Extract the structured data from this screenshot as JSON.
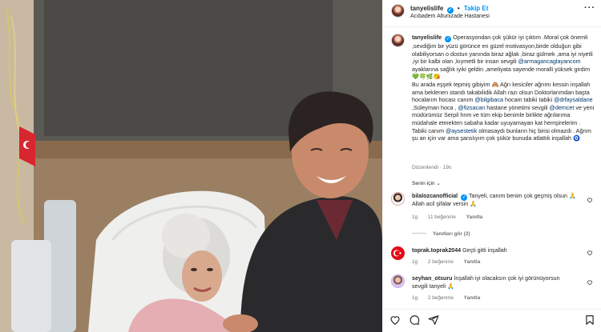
{
  "post": {
    "username": "tanyelislife",
    "verified_glyph": "✓",
    "follow_label": "Takip Et",
    "separator": "•",
    "location": "Acıbadem Altunizade Hastanesi",
    "more_glyph": "···"
  },
  "caption": {
    "username": "tanyelislife",
    "segments": [
      {
        "t": "Operasyondan çok şükür iyi çıktım .Moral çok önemli ,sevdiğim bir yüzü görünce en güzel motivasyon,birde olduğun gibi olabiliyorsan o dostun yanında biraz ağlak ,biraz gülmek ,ama iyi niyetli ,iyi bir kalbi olan ,kıymetli bir insan sevgili "
      },
      {
        "t": "@armagancaglayancom",
        "m": true
      },
      {
        "t": " ayaklarına sağlık iyiki geldin ,ameliyata sayende moralli yüksek girdim 💚🍀🌿😘"
      },
      {
        "br": true
      },
      {
        "t": "Bu arada eşşek tepmiş gibiyim 🙈 Ağrı kesiciler ağrımı kessin inşallah ama beklenen standı takabilidik Allah razı olsun Doktorlarımdan başta hocalarım hocası canım "
      },
      {
        "t": "@bilgibaca",
        "m": true
      },
      {
        "t": " hocam tabiki tabiki "
      },
      {
        "t": "@drfaysaldane",
        "m": true
      },
      {
        "t": " ,Süleyman hoca , "
      },
      {
        "t": "@fizsacan",
        "m": true
      },
      {
        "t": " hastane yönetimi sevgili "
      },
      {
        "t": "@demcet",
        "m": true
      },
      {
        "t": " ve yeni müdürümüz Serpil hnm ve tüm ekip benimle birlikte ağrılarıma müdahale etmekten sabaha kadar uyuyamayan kat hemşirelerim ."
      },
      {
        "br": true
      },
      {
        "t": "Tabiki canım "
      },
      {
        "t": "@aysestetik",
        "m": true
      },
      {
        "t": " olmasaydı bunların hiç birisi olmazdı . Ağrım şu an için var ama şanslıyım çok şükür bunuda atlattık inşallah 🧿"
      }
    ],
    "edited": "Düzenlendi · 19s"
  },
  "select_label": "Senin için",
  "select_caret": "⌄",
  "comments": [
    {
      "username": "bilalozcanofficial",
      "text": "Tanyeli, canım benim çok geçmiş olsun 🙏 Allah acil şifalar versin 🙏",
      "time": "1g",
      "likes": "11 beğenme",
      "reply": "Yanıtla",
      "view_replies": "Yanıtları gör (2)"
    },
    {
      "username": "toprak.toprak2044",
      "text": "Geçti gitti inşallah",
      "time": "1g",
      "likes": "2 beğenme",
      "reply": "Yanıtla"
    },
    {
      "username": "seyhan_otsuru",
      "text": "İnşallah iyi olacaksın çok iyi görünüyorsun sevgili tanyeli 🙏",
      "time": "1g",
      "likes": "2 beğenme",
      "reply": "Yanıtla"
    }
  ],
  "icons": {
    "like": "heart-icon",
    "comment": "comment-icon",
    "share": "share-icon",
    "save": "bookmark-icon"
  }
}
